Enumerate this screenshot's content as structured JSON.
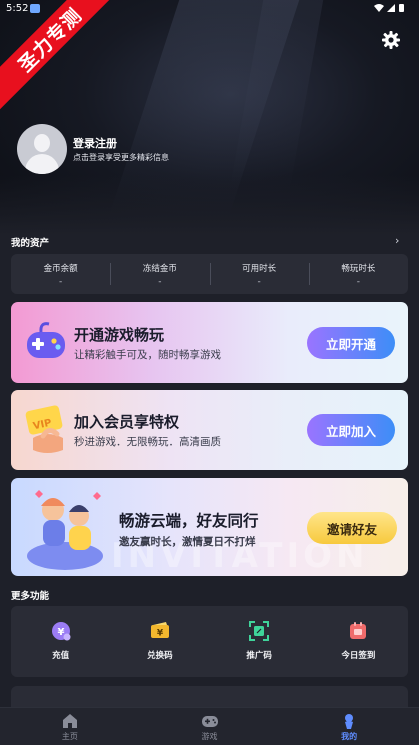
{
  "status": {
    "time": "5:52",
    "icons": "▾◢▮"
  },
  "ribbon_text": "圣力专测",
  "profile": {
    "title": "登录注册",
    "subtitle": "点击登录享受更多精彩信息"
  },
  "assets": {
    "section_title": "我的资产",
    "items": [
      {
        "label": "金币余额",
        "value": "-"
      },
      {
        "label": "冻结金币",
        "value": "-"
      },
      {
        "label": "可用时长",
        "value": "-"
      },
      {
        "label": "畅玩时长",
        "value": "-"
      }
    ]
  },
  "banners": [
    {
      "title": "开通游戏畅玩",
      "subtitle": "让精彩触手可及，随时畅享游戏",
      "button": "立即开通",
      "color": "#3d8ef7"
    },
    {
      "title": "加入会员享特权",
      "subtitle": "秒进游戏．无限畅玩．高清画质",
      "button": "立即加入",
      "badge": "VIP"
    },
    {
      "title": "畅游云端，好友同行",
      "subtitle": "邀友赢时长，激情夏日不打烊",
      "button": "邀请好友",
      "watermark": "INVITATION"
    }
  ],
  "more": {
    "section_title": "更多功能",
    "items": [
      {
        "label": "充值",
        "icon": "coin-icon"
      },
      {
        "label": "兑换码",
        "icon": "ticket-icon"
      },
      {
        "label": "推广码",
        "icon": "qr-scan-icon"
      },
      {
        "label": "今日签到",
        "icon": "calendar-icon"
      }
    ]
  },
  "tabs": [
    {
      "label": "主页",
      "icon": "home-icon",
      "active": false
    },
    {
      "label": "游戏",
      "icon": "gamepad-icon",
      "active": false
    },
    {
      "label": "我的",
      "icon": "profile-icon",
      "active": true
    }
  ],
  "accent": "#5f8dff"
}
